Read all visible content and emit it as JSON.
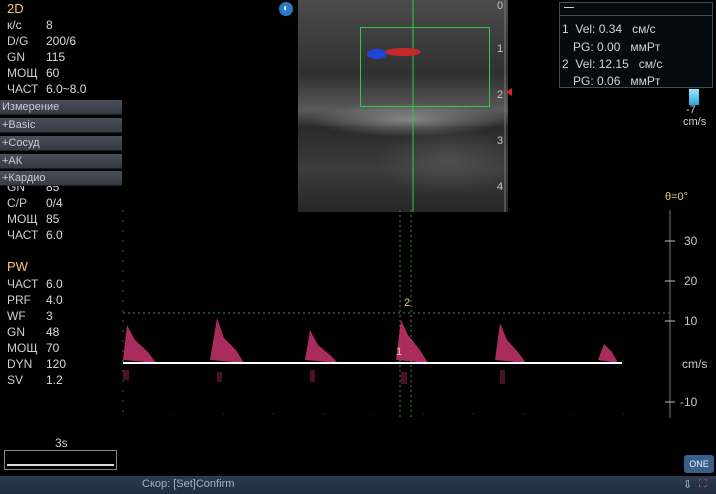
{
  "mode_2d": {
    "title": "2D",
    "params": [
      {
        "name": "к/с",
        "value": "8"
      },
      {
        "name": "D/G",
        "value": "200/6"
      },
      {
        "name": "GN",
        "value": "115"
      },
      {
        "name": "МОЩ",
        "value": "60"
      },
      {
        "name": "ЧАСТ",
        "value": "6.0~8.0"
      }
    ]
  },
  "menu": [
    "Измерение",
    "+Basic",
    "+Сосуд",
    "+АК",
    "+Кардио"
  ],
  "color_params": [
    {
      "name": "GN",
      "value": "85"
    },
    {
      "name": "C/P",
      "value": "0/4"
    },
    {
      "name": "МОЩ",
      "value": "85"
    },
    {
      "name": "ЧАСТ",
      "value": "6.0"
    }
  ],
  "mode_pw": {
    "title": "PW",
    "params": [
      {
        "name": "ЧАСТ",
        "value": "6.0"
      },
      {
        "name": "PRF",
        "value": "4.0"
      },
      {
        "name": "WF",
        "value": "3"
      },
      {
        "name": "GN",
        "value": "48"
      },
      {
        "name": "МОЩ",
        "value": "70"
      },
      {
        "name": "DYN",
        "value": "120"
      },
      {
        "name": "SV",
        "value": "1.2"
      }
    ]
  },
  "depth_scale": [
    "0",
    "1",
    "2",
    "3",
    "4"
  ],
  "measurements": [
    {
      "index": "1",
      "vel_label": "Vel:",
      "vel_value": "0.34",
      "vel_unit": "см/с",
      "pg_label": "PG:",
      "pg_value": "0.00",
      "pg_unit": "ммРт"
    },
    {
      "index": "2",
      "vel_label": "Vel:",
      "vel_value": "12.15",
      "vel_unit": "см/с",
      "pg_label": "PG:",
      "pg_value": "0.06",
      "pg_unit": "ммРт"
    }
  ],
  "color_bar": {
    "top": "",
    "bottom": "-7",
    "unit": "cm/s"
  },
  "angle": "θ=0°",
  "spectrum_scale": {
    "ticks": [
      "30",
      "20",
      "10",
      "",
      "-10"
    ],
    "unit": "cm/s"
  },
  "markers": {
    "m1": "1",
    "m2": "2"
  },
  "time_scale": "3s",
  "status": "Скор: [Set]Confirm",
  "logo": "ONE",
  "colors": {
    "accent": "#f5c878",
    "roi": "#2ecc40",
    "doppler": "#c8336e",
    "status_bg": "#23354a"
  }
}
